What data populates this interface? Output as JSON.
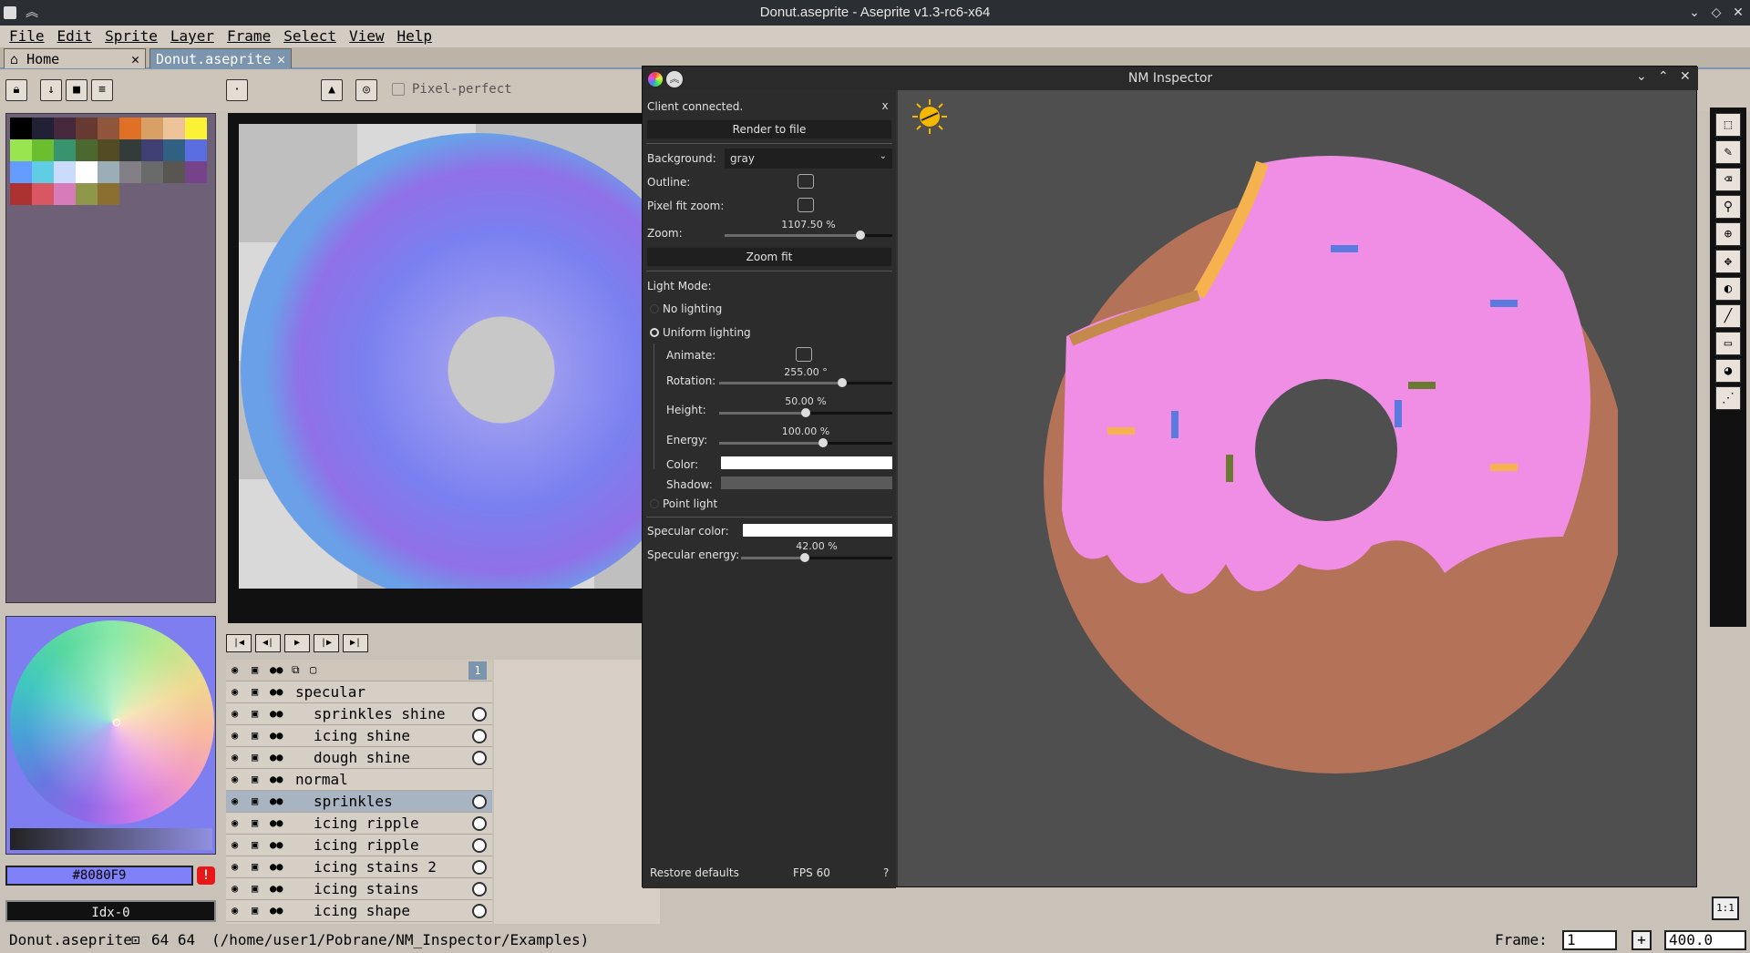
{
  "window": {
    "title": "Donut.aseprite - Aseprite v1.3-rc6-x64"
  },
  "menu": [
    "File",
    "Edit",
    "Sprite",
    "Layer",
    "Frame",
    "Select",
    "View",
    "Help"
  ],
  "tabs": [
    {
      "label": "Home",
      "close": "✕"
    },
    {
      "label": "Donut.aseprite",
      "close": "✕"
    }
  ],
  "toolbar": {
    "brush_size": "1px",
    "pixel_perfect": "Pixel-perfect"
  },
  "palette": [
    "#000000",
    "#222034",
    "#45283c",
    "#663931",
    "#8f563b",
    "#df7126",
    "#d9a066",
    "#eec39a",
    "#fbf236",
    "#99e550",
    "#6abe30",
    "#37946e",
    "#4b692f",
    "#524b24",
    "#323c39",
    "#3f3f74",
    "#306082",
    "#5b6ee1",
    "#639bff",
    "#5fcde4",
    "#cbdbfc",
    "#ffffff",
    "#9badb7",
    "#847e87",
    "#696a6a",
    "#595652",
    "#76428a",
    "#ac3232",
    "#d95763",
    "#d77bba",
    "#8f974a",
    "#8a6f30"
  ],
  "color": {
    "hex": "#8080F9",
    "index": "Idx-0"
  },
  "layers": [
    {
      "name": "specular",
      "group": true
    },
    {
      "name": "sprinkles shine",
      "group": false
    },
    {
      "name": "icing shine",
      "group": false
    },
    {
      "name": "dough shine",
      "group": false
    },
    {
      "name": "normal",
      "group": true
    },
    {
      "name": "sprinkles",
      "group": false,
      "selected": true
    },
    {
      "name": "icing ripple",
      "group": false
    },
    {
      "name": "icing ripple",
      "group": false
    },
    {
      "name": "icing stains 2",
      "group": false
    },
    {
      "name": "icing stains",
      "group": false
    },
    {
      "name": "icing shape",
      "group": false
    }
  ],
  "timeline": {
    "frame_header": "1"
  },
  "status": {
    "file": "Donut.aseprite",
    "size": "64 64",
    "path": "(/home/user1/Pobrane/NM_Inspector/Examples)",
    "frame_label": "Frame:",
    "frame_value": "1",
    "zoom": "400.0"
  },
  "inspector": {
    "title": "NM Inspector",
    "client_status": "Client connected.",
    "close_x": "x",
    "render_button": "Render to file",
    "background_label": "Background:",
    "background_value": "gray",
    "outline_label": "Outline:",
    "pixel_fit_label": "Pixel fit zoom:",
    "zoom_label": "Zoom:",
    "zoom_value": "1107.50 %",
    "zoom_fit_button": "Zoom fit",
    "light_mode_label": "Light Mode:",
    "no_lighting": "No lighting",
    "uniform_lighting": "Uniform lighting",
    "animate_label": "Animate:",
    "rotation_label": "Rotation:",
    "rotation_value": "255.00 °",
    "height_label": "Height:",
    "height_value": "50.00 %",
    "energy_label": "Energy:",
    "energy_value": "100.00 %",
    "color_label": "Color:",
    "shadow_label": "Shadow:",
    "point_light": "Point light",
    "specular_color_label": "Specular color:",
    "specular_energy_label": "Specular energy:",
    "specular_energy_value": "42.00 %",
    "restore_button": "Restore defaults",
    "fps": "FPS 60",
    "help": "?",
    "levels": {
      "zoom": 0.81,
      "rotation": 0.71,
      "height": 0.5,
      "energy": 0.6,
      "specular_energy": 0.42
    }
  }
}
